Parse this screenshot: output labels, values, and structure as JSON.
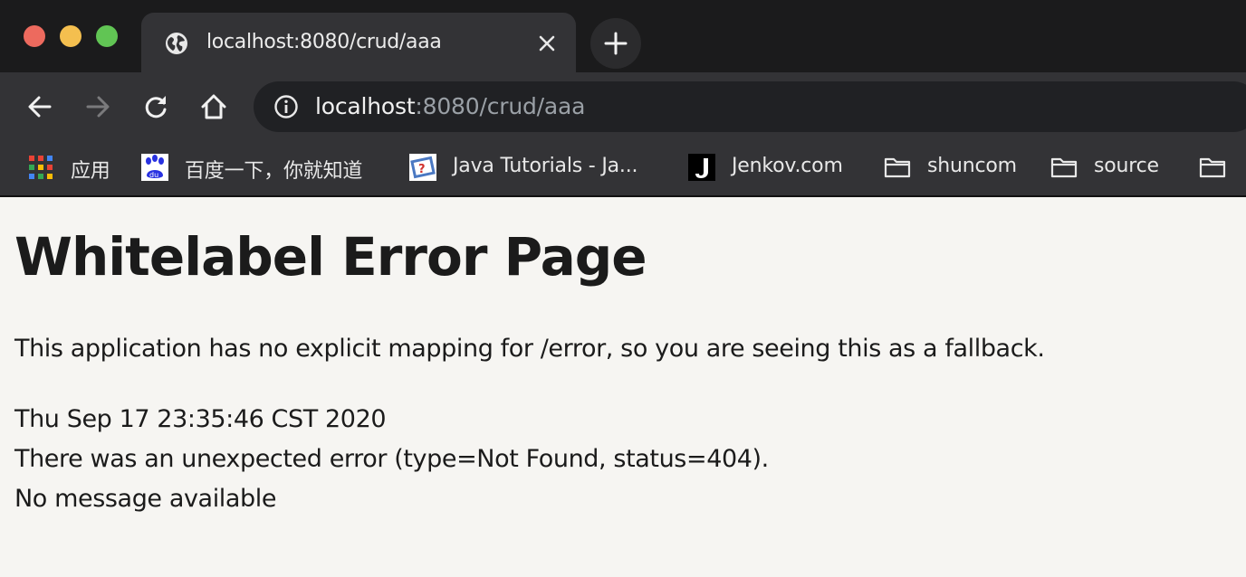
{
  "tab": {
    "title": "localhost:8080/crud/aaa"
  },
  "omnibox": {
    "host": "localhost",
    "rest": ":8080/crud/aaa"
  },
  "bookmarks": [
    {
      "label": "应用",
      "icon": "apps-grid-icon"
    },
    {
      "label": "百度一下，你就知道",
      "icon": "baidu-paw-icon"
    },
    {
      "label": "Java Tutorials - Ja...",
      "icon": "java-tutorials-icon"
    },
    {
      "label": "Jenkov.com",
      "icon": "jenkov-j-icon"
    },
    {
      "label": "shuncom",
      "icon": "folder-icon"
    },
    {
      "label": "source",
      "icon": "folder-icon"
    },
    {
      "label": "",
      "icon": "folder-icon"
    }
  ],
  "page": {
    "title": "Whitelabel Error Page",
    "description": "This application has no explicit mapping for /error, so you are seeing this as a fallback.",
    "timestamp": "Thu Sep 17 23:35:46 CST 2020",
    "error": "There was an unexpected error (type=Not Found, status=404).",
    "message": "No message available"
  },
  "colors": {
    "close": "#ed6a5e",
    "minimize": "#f4bf4f",
    "zoom": "#61c554",
    "page_background": "#f6f5f2",
    "toolbar": "#333336"
  }
}
